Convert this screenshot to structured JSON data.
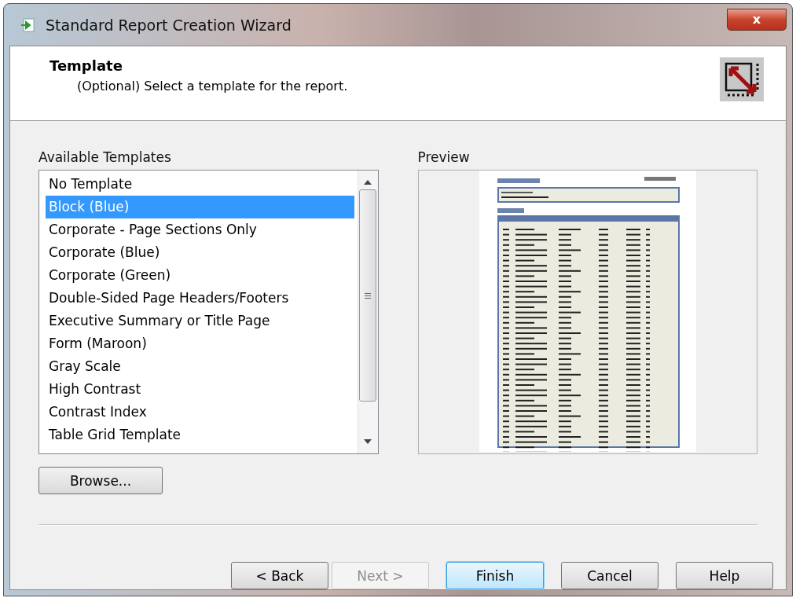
{
  "window": {
    "title": "Standard Report Creation Wizard",
    "close": "x"
  },
  "header": {
    "title": "Template",
    "subtitle": "(Optional) Select a template for the report."
  },
  "templates": {
    "label": "Available Templates",
    "items": [
      {
        "label": "No Template",
        "selected": false
      },
      {
        "label": "Block (Blue)",
        "selected": true
      },
      {
        "label": "Corporate - Page Sections Only",
        "selected": false
      },
      {
        "label": "Corporate (Blue)",
        "selected": false
      },
      {
        "label": "Corporate (Green)",
        "selected": false
      },
      {
        "label": "Double-Sided Page Headers/Footers",
        "selected": false
      },
      {
        "label": "Executive Summary or Title Page",
        "selected": false
      },
      {
        "label": "Form (Maroon)",
        "selected": false
      },
      {
        "label": "Gray Scale",
        "selected": false
      },
      {
        "label": "High Contrast",
        "selected": false
      },
      {
        "label": "Contrast Index",
        "selected": false
      },
      {
        "label": "Table Grid Template",
        "selected": false
      }
    ]
  },
  "preview": {
    "label": "Preview"
  },
  "browse": "Browse...",
  "buttons": [
    {
      "label": "< Back",
      "disabled": false,
      "default": false
    },
    {
      "label": "Next >",
      "disabled": true,
      "default": false
    },
    {
      "label": "Finish",
      "disabled": false,
      "default": true
    },
    {
      "label": "Cancel",
      "disabled": false,
      "default": false
    },
    {
      "label": "Help",
      "disabled": false,
      "default": false
    }
  ]
}
